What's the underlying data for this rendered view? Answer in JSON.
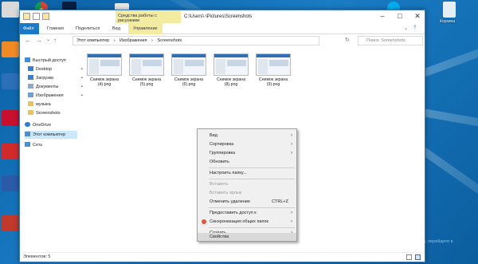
{
  "window": {
    "title": "C:\\Users\\·\\Pictures\\Screenshots",
    "context_group": "Средства работы с рисунками",
    "tabs": [
      "Файл",
      "Главная",
      "Поделиться",
      "Вид",
      "Управление"
    ]
  },
  "address": {
    "crumbs": [
      "Этот компьютер",
      "Изображения",
      "Screenshots"
    ],
    "search_placeholder": "Поиск: Screenshots"
  },
  "nav": {
    "items": [
      "Быстрый доступ",
      "Desktop",
      "Загрузки",
      "Документы",
      "Изображения",
      "музыка",
      "Screenshots",
      "OneDrive",
      "Этот компьютер",
      "Сеть"
    ]
  },
  "files": [
    {
      "name": "Снимок экрана (4).png"
    },
    {
      "name": "Снимок экрана (5).png"
    },
    {
      "name": "Снимок экрана (6).png"
    },
    {
      "name": "Снимок экрана (8).png"
    },
    {
      "name": "Снимок экрана (9).png"
    }
  ],
  "status": {
    "count": "Элементов: 5"
  },
  "menu": {
    "items": [
      {
        "label": "Вид",
        "arrow": true
      },
      {
        "label": "Сортировка",
        "arrow": true
      },
      {
        "label": "Группировка",
        "arrow": true
      },
      {
        "label": "Обновить"
      },
      {
        "label": "Настроить папку..."
      },
      {
        "label": "Вставить",
        "disabled": true
      },
      {
        "label": "Вставить ярлык",
        "disabled": true
      },
      {
        "label": "Отменить удаление",
        "accel": "CTRL+Z"
      },
      {
        "label": "Предоставить доступ к",
        "arrow": true
      },
      {
        "label": "Синхронизация общих папок",
        "arrow": true
      },
      {
        "label": "Создать",
        "arrow": true
      },
      {
        "label": "Свойства"
      }
    ]
  },
  "desktop": {
    "recycle_label": "Корзина",
    "watermark_title": "Активация Windows",
    "watermark_line1": "Чтобы активировать Windows, перейдите в",
    "watermark_line2": "раздел \"Параметры\"."
  }
}
